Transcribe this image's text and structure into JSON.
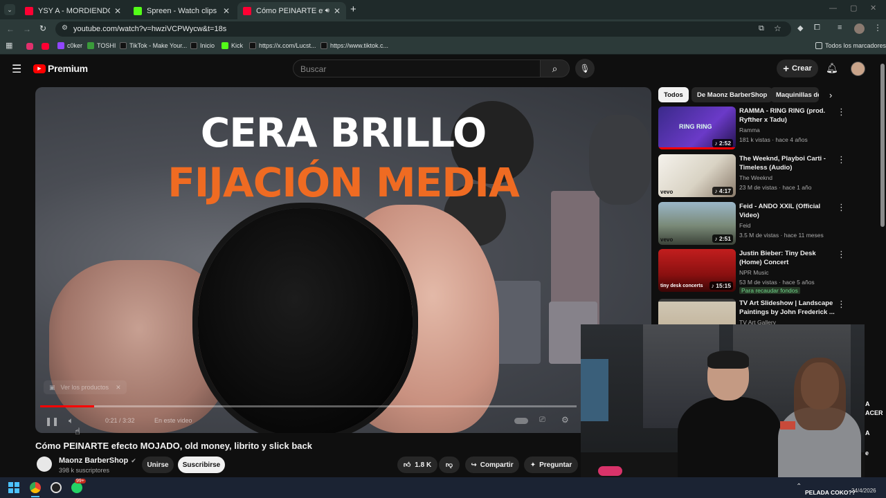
{
  "browser": {
    "tabs": [
      {
        "title": "YSY A - MORDIENDO EL BOZAL",
        "active": false,
        "favicon_color": "#ff0033"
      },
      {
        "title": "Spreen - Watch clips on Kick",
        "active": false,
        "favicon_color": "#53fc18"
      },
      {
        "title": "Cómo PEINARTE efecto MO",
        "active": true,
        "favicon_color": "#ff0033"
      }
    ],
    "new_tab": "+",
    "url": "youtube.com/watch?v=hwziVCPWycw&t=18s",
    "bookmarks": [
      "c0ker",
      "TOSHI",
      "TikTok - Make Your...",
      "Inicio",
      "Kick",
      "https://x.com/Lucst...",
      "https://www.tiktok.c..."
    ],
    "all_bookmarks": "Todos los marcadores"
  },
  "yt": {
    "brand": "Premium",
    "search_placeholder": "Buscar",
    "create_label": "Crear",
    "accent": "#ff0000"
  },
  "video": {
    "line1": "CERA BRILLO",
    "line2": "FIJACIÓN MEDIA",
    "product_chip": "Ver los productos",
    "time": "0:21 / 3:32",
    "chapter": "En este video",
    "progress_fraction": 0.1,
    "title": "Cómo PEINARTE efecto MOJADO, old money, librito y slick back",
    "channel": "Maonz BarberShop",
    "subscribers": "398 k suscriptores",
    "join": "Unirse",
    "subscribe": "Suscribirse",
    "likes": "1.8 K",
    "share": "Compartir",
    "ask": "Preguntar"
  },
  "chips": [
    "Todos",
    "De Maonz BarberShop",
    "Maquinillas de"
  ],
  "recommendations": [
    {
      "title": "RAMMA - RING RING (prod. Ryfther x Tadu)",
      "channel": "Ramma",
      "meta": "181 k vistas · hace 4 años",
      "duration": "2:52",
      "extra": ""
    },
    {
      "title": "The Weeknd, Playboi Carti - Timeless (Audio)",
      "channel": "The Weeknd",
      "meta": "23 M de vistas · hace 1 año",
      "duration": "4:17",
      "extra": ""
    },
    {
      "title": "Feid - ANDO XXIL (Official Video)",
      "channel": "Feid",
      "meta": "3.5 M de vistas · hace 11 meses",
      "duration": "2:51",
      "extra": ""
    },
    {
      "title": "Justin Bieber: Tiny Desk (Home) Concert",
      "channel": "NPR Music",
      "meta": "53 M de vistas · hace 5 años",
      "duration": "15:15",
      "extra": "Para recaudar fondos"
    },
    {
      "title": "TV Art Slideshow | Landscape Paintings by John Frederick ...",
      "channel": "TV Art Gallery",
      "meta": "",
      "duration": "",
      "extra": ""
    }
  ],
  "thumb_texts": {
    "ramma": "RING RING",
    "vevo": "vevo",
    "tinydesk": "tiny desk concerts"
  },
  "overlay": {
    "side_text": [
      "A",
      "ACER",
      "A",
      "e"
    ],
    "stream_caption": "PELADA COKO??",
    "date": "24/4/2026",
    "notif_badge": "99+"
  }
}
